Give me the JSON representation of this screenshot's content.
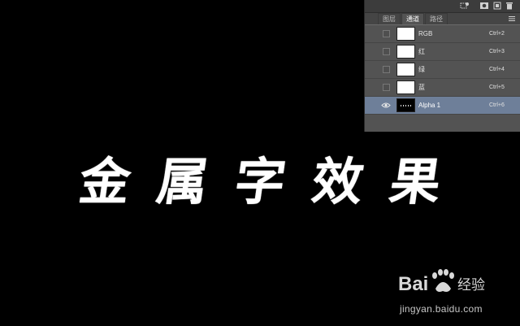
{
  "canvas": {
    "title_text": [
      "金",
      "属",
      "字",
      "效",
      "果"
    ],
    "background": "#000000",
    "text_color": "#ffffff"
  },
  "panel": {
    "toolbar_icons": [
      "load-selection-icon",
      "save-selection-icon",
      "new-channel-icon",
      "delete-icon"
    ],
    "tabs": [
      {
        "label": "图层",
        "active": false
      },
      {
        "label": "通道",
        "active": true
      },
      {
        "label": "路径",
        "active": false
      }
    ],
    "channels": [
      {
        "name": "RGB",
        "shortcut": "Ctrl+2",
        "visible": false,
        "selected": false
      },
      {
        "name": "红",
        "shortcut": "Ctrl+3",
        "visible": false,
        "selected": false
      },
      {
        "name": "绿",
        "shortcut": "Ctrl+4",
        "visible": false,
        "selected": false
      },
      {
        "name": "蓝",
        "shortcut": "Ctrl+5",
        "visible": false,
        "selected": false
      },
      {
        "name": "Alpha 1",
        "shortcut": "Ctrl+6",
        "visible": true,
        "selected": true
      }
    ],
    "selected_color": "#6e7f99"
  },
  "watermark": {
    "brand": "Baidu经验",
    "url": "jingyan.baidu.com"
  }
}
